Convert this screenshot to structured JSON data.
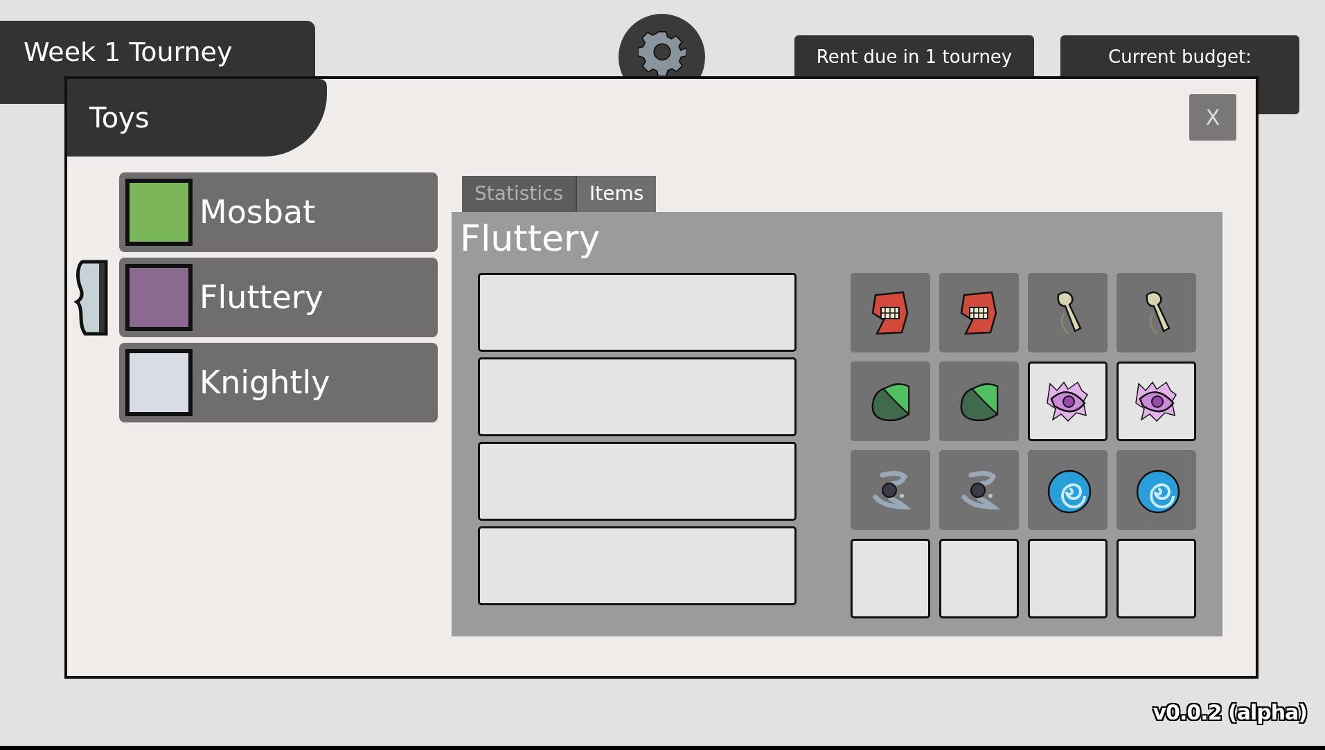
{
  "header": {
    "title": "Week 1 Tourney",
    "rent": "Rent due in 1 tourney",
    "budget": "Current budget:"
  },
  "dialog": {
    "title": "Toys",
    "close": "X"
  },
  "toys": [
    {
      "name": "Mosbat",
      "color": "#7cb65a",
      "selected": false
    },
    {
      "name": "Fluttery",
      "color": "#8a6a8e",
      "selected": true
    },
    {
      "name": "Knightly",
      "color": "#d8dce4",
      "selected": false
    }
  ],
  "tabs": [
    {
      "label": "Statistics",
      "selected": false
    },
    {
      "label": "Items",
      "selected": true
    }
  ],
  "panel": {
    "title": "Fluttery",
    "slots": [
      {
        "kind": "empty"
      },
      {
        "kind": "empty"
      },
      {
        "kind": "empty"
      },
      {
        "kind": "empty"
      }
    ],
    "items": [
      {
        "kind": "mouth",
        "highlighted": false
      },
      {
        "kind": "mouth",
        "highlighted": false
      },
      {
        "kind": "bone",
        "highlighted": false
      },
      {
        "kind": "bone",
        "highlighted": false
      },
      {
        "kind": "leaf",
        "highlighted": false
      },
      {
        "kind": "leaf",
        "highlighted": false
      },
      {
        "kind": "eye",
        "highlighted": true
      },
      {
        "kind": "eye",
        "highlighted": true
      },
      {
        "kind": "orb",
        "highlighted": false
      },
      {
        "kind": "orb",
        "highlighted": false
      },
      {
        "kind": "swirl",
        "highlighted": false
      },
      {
        "kind": "swirl",
        "highlighted": false
      },
      {
        "kind": "empty"
      },
      {
        "kind": "empty"
      },
      {
        "kind": "empty"
      },
      {
        "kind": "empty"
      }
    ]
  },
  "version": "v0.0.2 (alpha)"
}
